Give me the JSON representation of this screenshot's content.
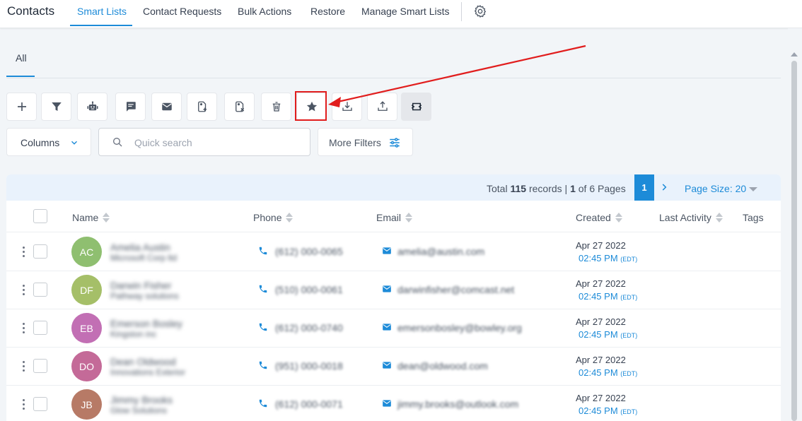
{
  "colors": {
    "accent": "#1d8bd8",
    "highlight": "#e11d1d"
  },
  "header": {
    "title": "Contacts",
    "tabs": [
      {
        "label": "Smart Lists",
        "active": true
      },
      {
        "label": "Contact Requests"
      },
      {
        "label": "Bulk Actions"
      },
      {
        "label": "Restore"
      },
      {
        "label": "Manage Smart Lists"
      }
    ],
    "settings_icon": "gear-icon"
  },
  "subtabs": [
    {
      "label": "All",
      "active": true
    }
  ],
  "toolbar": {
    "buttons": [
      {
        "icon": "plus-icon"
      },
      {
        "icon": "filter-icon"
      },
      {
        "icon": "robot-icon"
      },
      {
        "icon": "message-icon"
      },
      {
        "icon": "email-icon"
      },
      {
        "icon": "add-tag-icon"
      },
      {
        "icon": "remove-tag-icon"
      },
      {
        "icon": "trash-icon"
      },
      {
        "icon": "star-icon",
        "highlighted": true
      },
      {
        "icon": "import-icon"
      },
      {
        "icon": "export-icon"
      },
      {
        "icon": "merge-icon"
      }
    ]
  },
  "filters": {
    "columns_label": "Columns",
    "search_placeholder": "Quick search",
    "more_filters_label": "More Filters"
  },
  "pagination": {
    "total_prefix": "Total",
    "total_count": "115",
    "total_suffix": "records |",
    "current_page": "1",
    "pages_suffix": "of 6 Pages",
    "page_size_label": "Page Size: 20"
  },
  "table": {
    "columns": [
      "Name",
      "Phone",
      "Email",
      "Created",
      "Last Activity",
      "Tags"
    ],
    "rows": [
      {
        "initials": "AC",
        "avatar_color": "#8fbf70",
        "name": "Amelia Austin",
        "company": "Microsoft Corp ltd",
        "phone": "(612) 000-0065",
        "email": "amelia@austin.com",
        "created_date": "Apr 27 2022",
        "created_time": "02:45 PM",
        "tz": "(EDT)"
      },
      {
        "initials": "DF",
        "avatar_color": "#a5bf68",
        "name": "Darwin Fisher",
        "company": "Pathway solutions",
        "phone": "(510) 000-0061",
        "email": "darwinfisher@comcast.net",
        "created_date": "Apr 27 2022",
        "created_time": "02:45 PM",
        "tz": "(EDT)"
      },
      {
        "initials": "EB",
        "avatar_color": "#c26fb4",
        "name": "Emerson Bosley",
        "company": "Kingston inc",
        "phone": "(612) 000-0740",
        "email": "emersonbosley@bowley.org",
        "created_date": "Apr 27 2022",
        "created_time": "02:45 PM",
        "tz": "(EDT)"
      },
      {
        "initials": "DO",
        "avatar_color": "#c46a98",
        "name": "Dean Oldwood",
        "company": "Innovations Exterior",
        "phone": "(951) 000-0018",
        "email": "dean@oldwood.com",
        "created_date": "Apr 27 2022",
        "created_time": "02:45 PM",
        "tz": "(EDT)"
      },
      {
        "initials": "JB",
        "avatar_color": "#b77a66",
        "name": "Jimmy Brooks",
        "company": "Glow Solutions",
        "phone": "(612) 000-0071",
        "email": "jimmy.brooks@outlook.com",
        "created_date": "Apr 27 2022",
        "created_time": "02:45 PM",
        "tz": "(EDT)"
      }
    ]
  }
}
